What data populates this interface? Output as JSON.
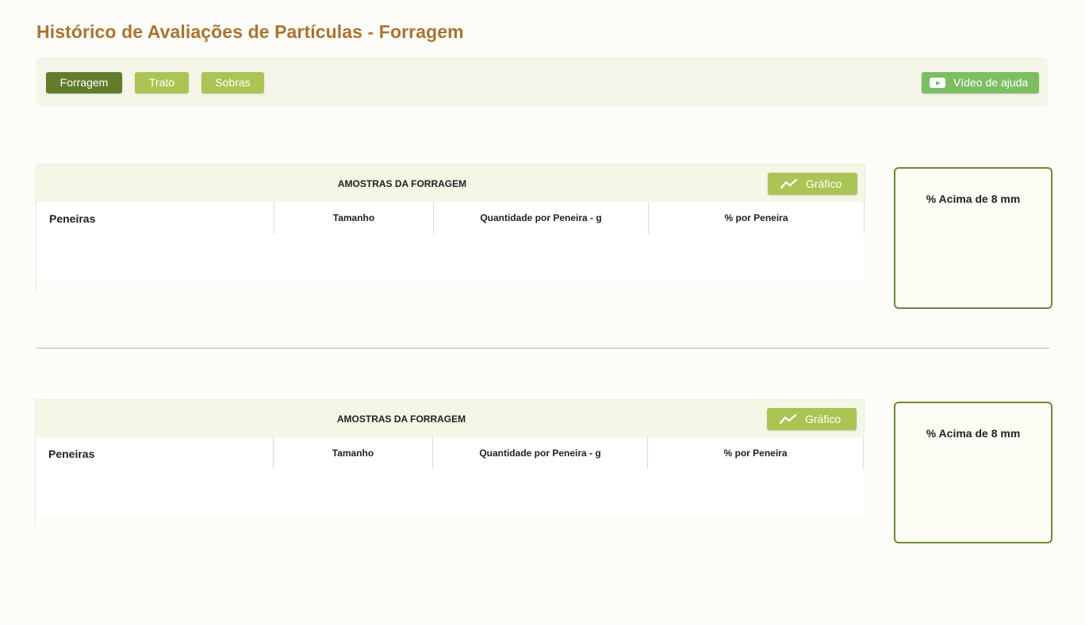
{
  "page": {
    "title": "Histórico de Avaliações de Partículas - Forragem"
  },
  "toolbar": {
    "tabs": [
      {
        "label": "Forragem",
        "active": true
      },
      {
        "label": "Trato",
        "active": false
      },
      {
        "label": "Sobras",
        "active": false
      }
    ],
    "help_button": {
      "label": "Vídeo de ajuda",
      "icon": "youtube-play-icon"
    }
  },
  "colors": {
    "title": "#a87432",
    "tab_active": "#617c2d",
    "tab_inactive": "#abc555",
    "help_button": "#7dbe64",
    "card_border": "#6e8a34"
  },
  "sections": [
    {
      "panel_title": "AMOSTRAS DA FORRAGEM",
      "chart_button": {
        "label": "Gráfico",
        "icon": "line-chart-icon"
      },
      "columns": [
        "Peneiras",
        "Tamanho",
        "Quantidade por Peneira - g",
        "% por  Peneira"
      ],
      "rows": [],
      "side_card": {
        "title": "% Acima de 8 mm",
        "value": ""
      }
    },
    {
      "panel_title": "AMOSTRAS DA FORRAGEM",
      "chart_button": {
        "label": "Gráfico",
        "icon": "line-chart-icon"
      },
      "columns": [
        "Peneiras",
        "Tamanho",
        "Quantidade por Peneira - g",
        "% por  Peneira"
      ],
      "rows": [],
      "side_card": {
        "title": "% Acima de 8 mm",
        "value": ""
      }
    }
  ]
}
